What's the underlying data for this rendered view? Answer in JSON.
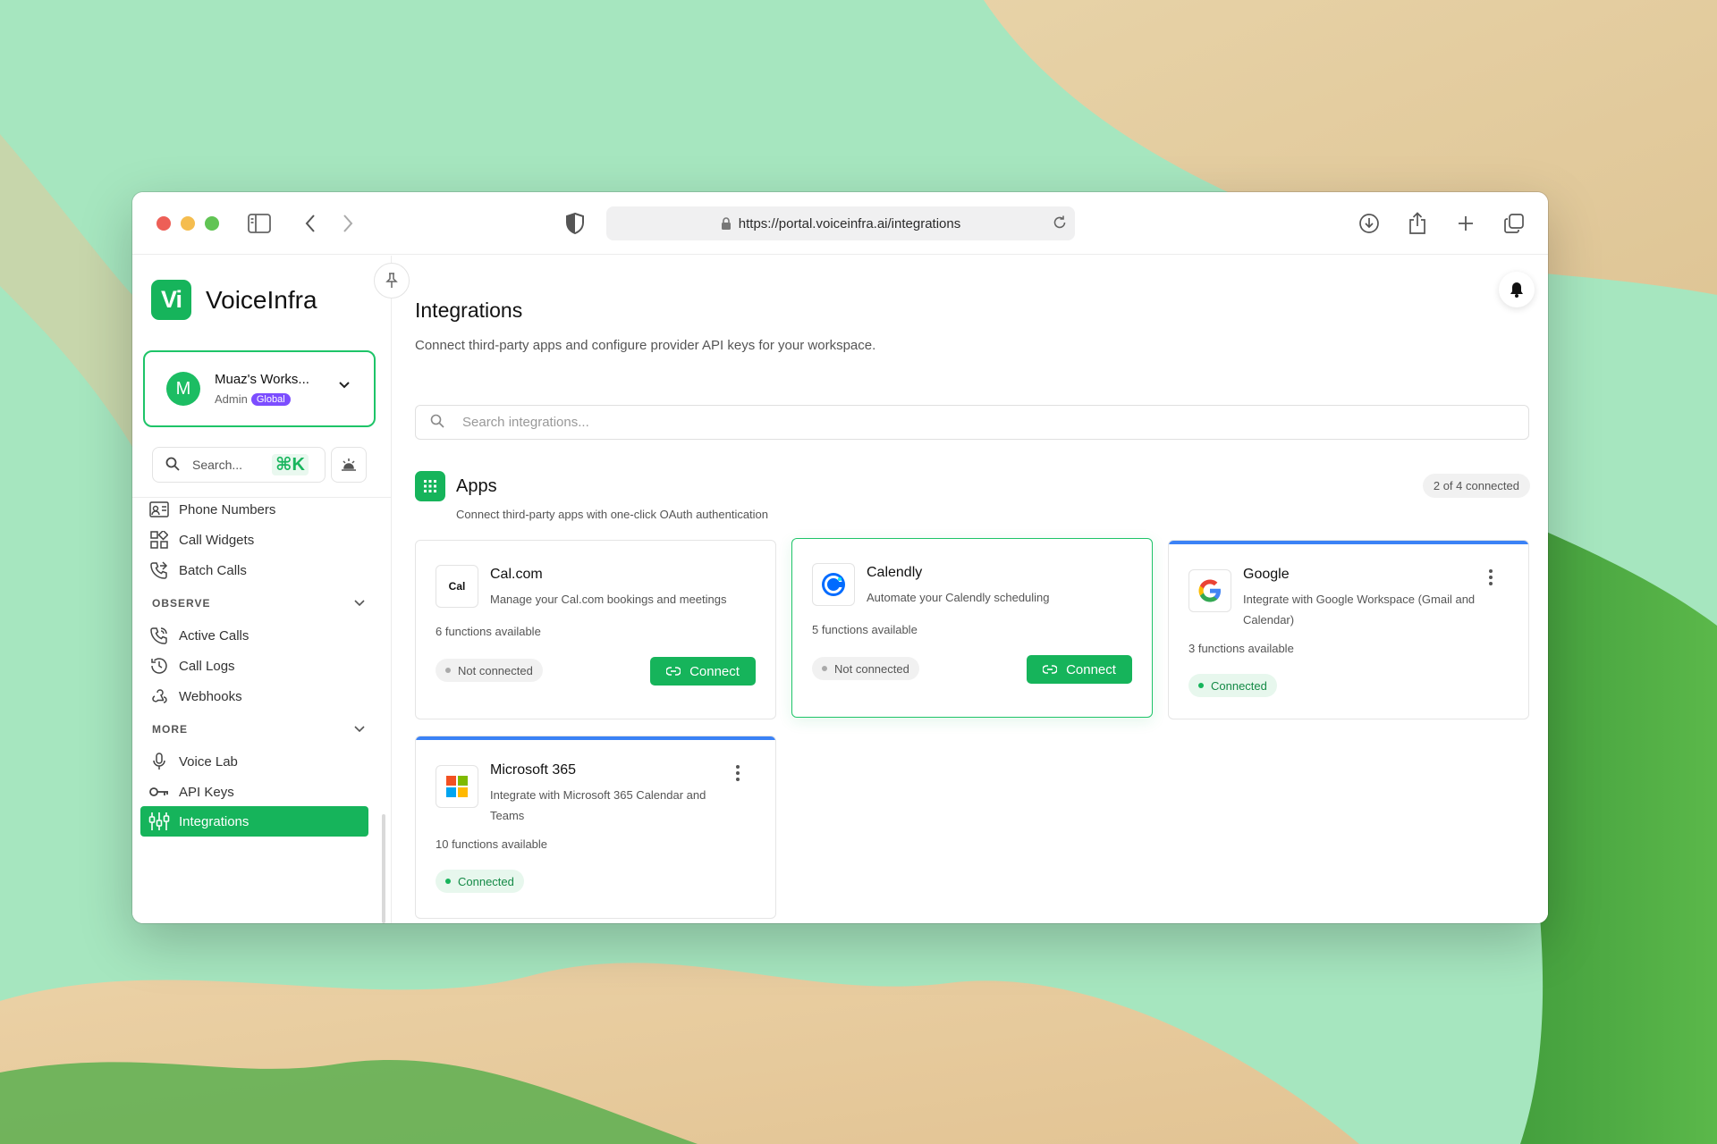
{
  "browser": {
    "url": "https://portal.voiceinfra.ai/integrations"
  },
  "sidebar": {
    "brand": "VoiceInfra",
    "brand_mark": "Vi",
    "workspace": {
      "avatar_letter": "M",
      "name": "Muaz's Works...",
      "role": "Admin",
      "badge": "Global"
    },
    "search": {
      "placeholder": "Search...",
      "shortcut": "⌘K"
    },
    "items_top": [
      {
        "label": "Phone Numbers",
        "icon": "contact-card-icon"
      },
      {
        "label": "Call Widgets",
        "icon": "widgets-icon"
      },
      {
        "label": "Batch Calls",
        "icon": "phone-forward-icon"
      }
    ],
    "sections": [
      {
        "title": "OBSERVE",
        "items": [
          {
            "label": "Active Calls",
            "icon": "phone-incoming-icon"
          },
          {
            "label": "Call Logs",
            "icon": "history-icon"
          },
          {
            "label": "Webhooks",
            "icon": "webhook-icon"
          }
        ]
      },
      {
        "title": "MORE",
        "items": [
          {
            "label": "Voice Lab",
            "icon": "microphone-icon"
          },
          {
            "label": "API Keys",
            "icon": "key-icon"
          },
          {
            "label": "Integrations",
            "icon": "integrations-icon",
            "active": true
          }
        ]
      }
    ]
  },
  "main": {
    "title": "Integrations",
    "subtitle": "Connect third-party apps and configure provider API keys for your workspace.",
    "search_placeholder": "Search integrations...",
    "apps": {
      "title": "Apps",
      "description": "Connect third-party apps with one-click OAuth authentication",
      "count": "2 of 4 connected"
    },
    "cards": [
      {
        "name": "Cal.com",
        "logo_text": "Cal",
        "description": "Manage your Cal.com bookings and meetings",
        "functions": "6 functions available",
        "status": "Not connected",
        "action": "Connect"
      },
      {
        "name": "Calendly",
        "description": "Automate your Calendly scheduling",
        "functions": "5 functions available",
        "status": "Not connected",
        "action": "Connect"
      },
      {
        "name": "Google",
        "description": "Integrate with Google Workspace (Gmail and Calendar)",
        "functions": "3 functions available",
        "status": "Connected"
      },
      {
        "name": "Microsoft 365",
        "description": "Integrate with Microsoft 365 Calendar and Teams",
        "functions": "10 functions available",
        "status": "Connected"
      }
    ]
  },
  "colors": {
    "brand_green": "#16b45b",
    "connected_bar": "#3b82f6",
    "badge_purple": "#7c4dff"
  }
}
